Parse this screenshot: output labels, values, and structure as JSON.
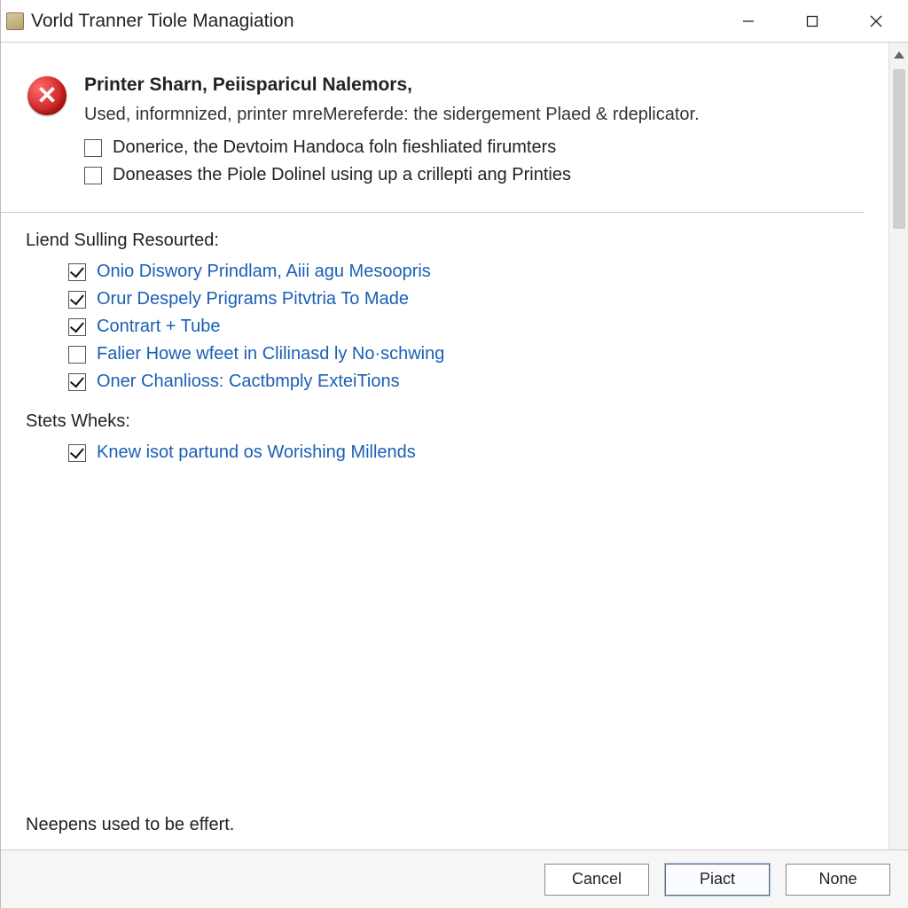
{
  "window": {
    "title": "Vorld Tranner Tiole Managiation"
  },
  "header": {
    "title": "Printer Sharn, Peiisparicul Nalemors,",
    "description": "Used, informnized, printer mreMereferde: the sidergement Plaed & rdeplicator.",
    "options": [
      {
        "label": "Donerice, the Devtoim Handoca foln fieshliated firumters",
        "checked": false
      },
      {
        "label": "Doneases the Piole Dolinel using up a crillepti ang Printies",
        "checked": false
      }
    ]
  },
  "section1": {
    "label": "Liend Sulling Resourted:",
    "items": [
      {
        "label": "Onio Diswory Prindlam, Aiii agu Mesoopris",
        "checked": true
      },
      {
        "label": "Orur Despely Prigrams Pitvtria To Made",
        "checked": true
      },
      {
        "label": "Contrart + Tube",
        "checked": true
      },
      {
        "label": "Falier Howe wfeet in Clilinasd ly No·schwing",
        "checked": false
      },
      {
        "label": "Oner Chanlioss: Cactbmply ExteiTions",
        "checked": true
      }
    ]
  },
  "section2": {
    "label": "Stets Wheks:",
    "items": [
      {
        "label": "Knew isot partund os Worishing Millends",
        "checked": true
      }
    ]
  },
  "footer_note": "Neepens used to be effert.",
  "buttons": {
    "cancel": "Cancel",
    "place": "Piact",
    "none": "None"
  }
}
